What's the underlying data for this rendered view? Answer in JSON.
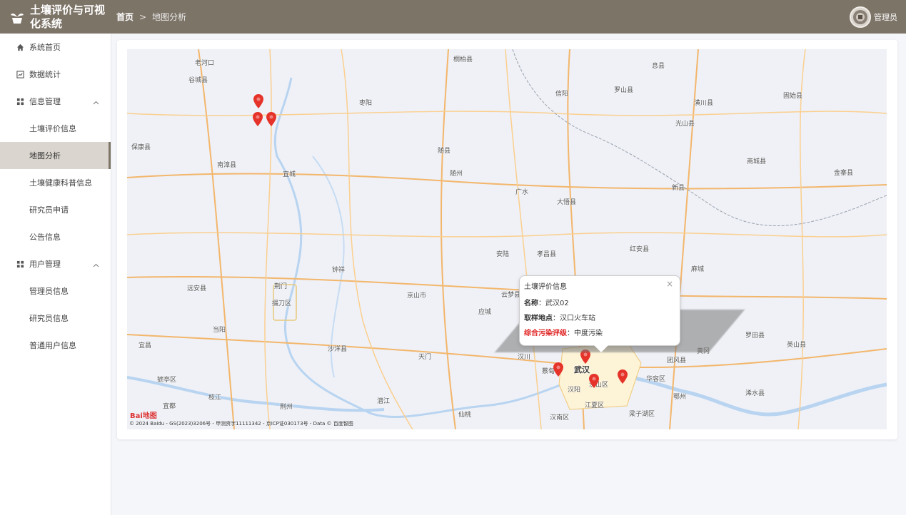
{
  "header": {
    "app_title": "土壤评价与可视化系统",
    "breadcrumb_home": "首页",
    "breadcrumb_sep": ">",
    "breadcrumb_current": "地图分析",
    "user_name": "管理员"
  },
  "sidebar": {
    "items": [
      {
        "label": "系统首页",
        "icon": "home-icon"
      },
      {
        "label": "数据统计",
        "icon": "chart-icon"
      }
    ],
    "groups": [
      {
        "label": "信息管理",
        "icon": "grid-icon",
        "children": [
          "土壤评价信息",
          "地图分析",
          "土壤健康科普信息",
          "研究员申请",
          "公告信息"
        ]
      },
      {
        "label": "用户管理",
        "icon": "grid-icon",
        "children": [
          "管理员信息",
          "研究员信息",
          "普通用户信息"
        ]
      }
    ],
    "active_item": "地图分析"
  },
  "map": {
    "places": [
      "老河口",
      "谷城县",
      "保康县",
      "南漳县",
      "宜城",
      "枣阳",
      "桐柏县",
      "随县",
      "随州",
      "信阳",
      "息县",
      "罗山县",
      "潢川县",
      "光山县",
      "固始县",
      "商城县",
      "新县",
      "金寨县",
      "广水",
      "大悟县",
      "红安县",
      "麻城",
      "安陆",
      "孝昌县",
      "钟祥",
      "京山市",
      "云梦县",
      "应城",
      "远安县",
      "荆门",
      "掇刀区",
      "当阳",
      "沙洋县",
      "天门",
      "汉川",
      "武汉",
      "蔡甸",
      "汉阳",
      "洪山区",
      "华容区",
      "团风县",
      "罗田县",
      "英山县",
      "浠水县",
      "黄冈",
      "鄂州",
      "江夏区",
      "梁子湖区",
      "汉南区",
      "仙桃",
      "潜江",
      "荆州",
      "枝江",
      "宜都",
      "宜昌",
      "猇亭区"
    ],
    "popup": {
      "title": "土壤评价信息",
      "close": "×",
      "name_label": "名称",
      "name_value": "武汉02",
      "location_label": "取样地点",
      "location_value": "汉口火车站",
      "rating_label": "综合污染评级",
      "rating_value": "中度污染"
    },
    "logo": "Bai地图",
    "copyright": "© 2024 Baidu - GS(2023)3206号 - 甲测资字11111342 - 京ICP证030173号 - Data © 百度智图",
    "marker_color": "#e6332a"
  }
}
